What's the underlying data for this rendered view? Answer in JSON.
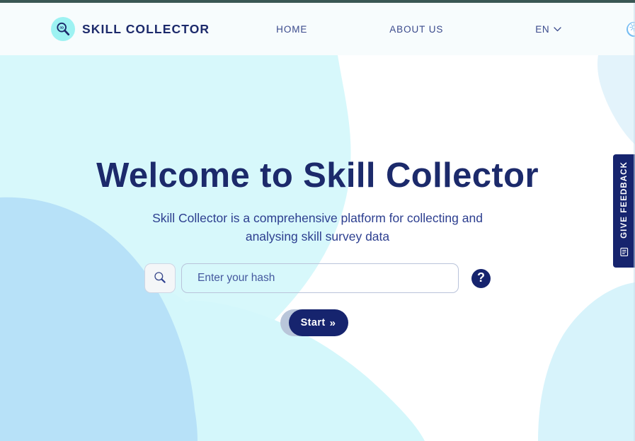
{
  "header": {
    "brand_name": "SKILL COLLECTOR",
    "brand_icon": "magnifier-logo-icon",
    "nav": [
      {
        "id": "home",
        "label": "HOME"
      },
      {
        "id": "about",
        "label": "ABOUT US"
      }
    ],
    "language": {
      "label": "EN",
      "chevron_icon": "chevron-down-icon"
    },
    "theme_toggle": {
      "state": "light",
      "knob_icon": "sun-icon",
      "track_color": "#76bdf2",
      "knob_color": "#ffffff"
    }
  },
  "hero": {
    "title": "Welcome to Skill Collector",
    "subtitle": "Skill Collector is a comprehensive platform for collecting and analysing skill survey data",
    "search": {
      "placeholder": "Enter your hash",
      "value": "",
      "search_icon": "search-icon",
      "help_label": "?",
      "help_icon": "question-mark-icon"
    },
    "start_button": {
      "label": "Start",
      "chevrons": "»"
    }
  },
  "feedback_tab": {
    "label": "GIVE FEEDBACK",
    "icon": "feedback-note-icon"
  },
  "colors": {
    "navy": "#16246e",
    "title_navy": "#1c2a6b",
    "text_blue": "#2c3e8f",
    "header_bg": "#f7fcfd",
    "blob_pale_cyan": "#d6f7fb",
    "blob_cyan": "#cdf6fa",
    "blob_blue": "#b6e0f7",
    "logo_circle": "#9df2f2",
    "top_edge": "#3a5754"
  }
}
